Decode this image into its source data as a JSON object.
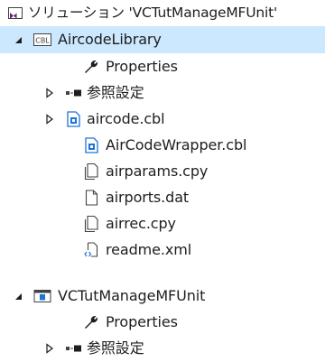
{
  "solution_explorer": {
    "solution": {
      "label": "ソリューション 'VCTutManageMFUnit'",
      "icon": "solution-icon"
    },
    "projects": [
      {
        "label": "AircodeLibrary",
        "icon": "cobol-project-icon",
        "expanded": true,
        "selected": true,
        "items": [
          {
            "label": "Properties",
            "icon": "wrench-icon",
            "expandable": false
          },
          {
            "label": "参照設定",
            "icon": "references-icon",
            "expandable": true
          },
          {
            "label": "aircode.cbl",
            "icon": "cobol-file-icon",
            "expandable": true
          },
          {
            "label": "AirCodeWrapper.cbl",
            "icon": "cobol-file-icon",
            "expandable": false
          },
          {
            "label": "airparams.cpy",
            "icon": "copybook-icon",
            "expandable": false
          },
          {
            "label": "airports.dat",
            "icon": "document-icon",
            "expandable": false
          },
          {
            "label": "airrec.cpy",
            "icon": "copybook-icon",
            "expandable": false
          },
          {
            "label": "readme.xml",
            "icon": "xml-file-icon",
            "expandable": false
          }
        ]
      },
      {
        "label": "VCTutManageMFUnit",
        "icon": "unit-test-project-icon",
        "expanded": true,
        "selected": false,
        "items": [
          {
            "label": "Properties",
            "icon": "wrench-icon",
            "expandable": false
          },
          {
            "label": "参照設定",
            "icon": "references-icon",
            "expandable": true
          }
        ]
      }
    ],
    "colors": {
      "selection": "#cce8ff",
      "accent_blue": "#1e73d6",
      "text": "#1e1e1e"
    }
  }
}
